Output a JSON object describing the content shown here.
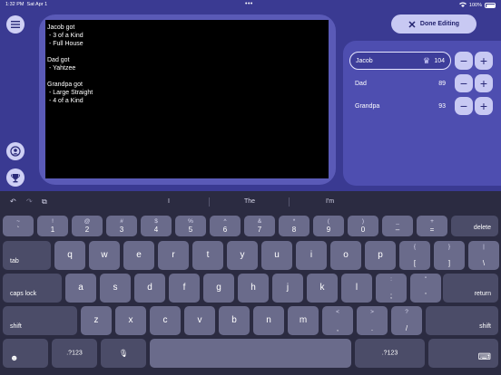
{
  "status_bar": {
    "time": "1:32 PM",
    "date": "Sat Apr 1",
    "multitask_dots": "•••",
    "battery": "100%"
  },
  "icons": {
    "menu": "hamburger-menu-icon",
    "players": "users-icon",
    "trophy": "trophy-icon",
    "close": "x-icon",
    "crown": "crown-icon"
  },
  "notes": {
    "text": "Jacob got\n - 3 of a Kind\n - Full House\n\nDad got\n - Yahtzee\n\nGrandpa got\n - Large Straight\n - 4 of a Kind"
  },
  "done_button": {
    "label": "Done Editing"
  },
  "players": [
    {
      "name": "Jacob",
      "score": "104",
      "leader": true
    },
    {
      "name": "Dad",
      "score": "89",
      "leader": false
    },
    {
      "name": "Grandpa",
      "score": "93",
      "leader": false
    }
  ],
  "stepper": {
    "minus": "−",
    "plus": "+"
  },
  "keyboard": {
    "toolbar": {
      "undo": "↶",
      "redo": "↷",
      "paste": "⧉"
    },
    "suggestions": [
      "I",
      "The",
      "I'm"
    ],
    "row1": [
      {
        "t": "~",
        "b": "`"
      },
      {
        "t": "!",
        "b": "1"
      },
      {
        "t": "@",
        "b": "2"
      },
      {
        "t": "#",
        "b": "3"
      },
      {
        "t": "$",
        "b": "4"
      },
      {
        "t": "%",
        "b": "5"
      },
      {
        "t": "^",
        "b": "6"
      },
      {
        "t": "&",
        "b": "7"
      },
      {
        "t": "*",
        "b": "8"
      },
      {
        "t": "(",
        "b": "9"
      },
      {
        "t": ")",
        "b": "0"
      },
      {
        "t": "_",
        "b": "–"
      },
      {
        "t": "+",
        "b": "="
      }
    ],
    "delete": "delete",
    "tab": "tab",
    "row2": [
      "q",
      "w",
      "e",
      "r",
      "t",
      "y",
      "u",
      "i",
      "o",
      "p"
    ],
    "row2_extra": [
      {
        "t": "{",
        "b": "["
      },
      {
        "t": "}",
        "b": "]"
      },
      {
        "t": "|",
        "b": "\\"
      }
    ],
    "caps_lock": "caps lock",
    "row3": [
      "a",
      "s",
      "d",
      "f",
      "g",
      "h",
      "j",
      "k",
      "l"
    ],
    "row3_extra": [
      {
        "t": ":",
        "b": ";"
      },
      {
        "t": "\"",
        "b": "'"
      }
    ],
    "return": "return",
    "shift": "shift",
    "row4": [
      "z",
      "x",
      "c",
      "v",
      "b",
      "n",
      "m"
    ],
    "row4_extra": [
      {
        "t": "<",
        "b": ","
      },
      {
        "t": ">",
        "b": "."
      },
      {
        "t": "?",
        "b": "/"
      }
    ],
    "emoji": "☻",
    "numbers": ".?123",
    "mic": "🎙",
    "keyboard_hide": "⌨"
  }
}
